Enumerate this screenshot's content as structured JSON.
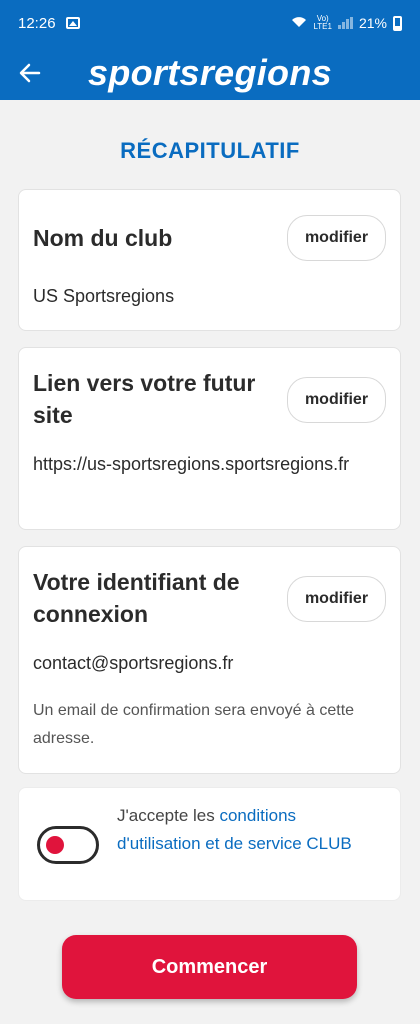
{
  "status_bar": {
    "time": "12:26",
    "battery_percent": "21%",
    "network_label": "LTE1"
  },
  "app_bar": {
    "logo": "sportsregions"
  },
  "page_title": "RÉCAPITULATIF",
  "cards": {
    "club": {
      "title": "Nom du club",
      "button": "modifier",
      "value": "US Sportsregions"
    },
    "site": {
      "title": "Lien vers votre futur site",
      "button": "modifier",
      "value": "https://us-sportsregions.sportsregions.fr"
    },
    "login": {
      "title": "Votre identifiant de connexion",
      "button": "modifier",
      "value": "contact@sportsregions.fr",
      "note": "Un email de confirmation sera envoyé à cette adresse."
    }
  },
  "accept": {
    "prefix": "J'accepte les ",
    "link": "conditions d'utilisation et de service CLUB",
    "toggle_on": false,
    "toggle_color": "#e0143c"
  },
  "start_button": "Commencer",
  "colors": {
    "brand_blue": "#0a6cc0",
    "accent_red": "#e0143c"
  }
}
